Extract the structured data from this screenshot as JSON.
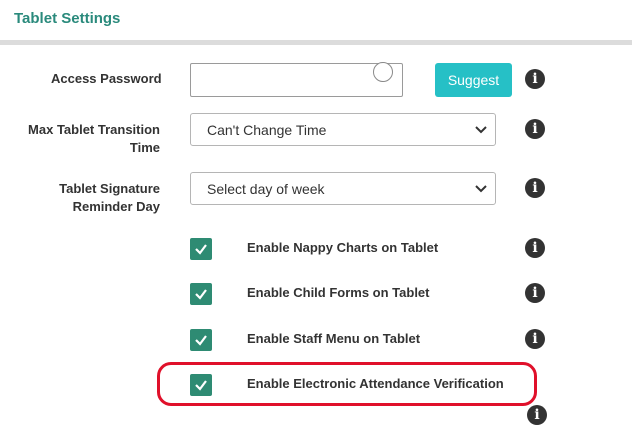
{
  "panel": {
    "title": "Tablet Settings"
  },
  "fields": {
    "access_password": {
      "label": "Access Password",
      "value": "",
      "button": "Suggest"
    },
    "max_transition": {
      "label_line1": "Max Tablet Transition",
      "label_line2": "Time",
      "selected": "Can't Change Time"
    },
    "signature_day": {
      "label_line1": "Tablet Signature",
      "label_line2": "Reminder Day",
      "selected": "Select day of week"
    }
  },
  "checkboxes": [
    {
      "label": "Enable Nappy Charts on Tablet",
      "checked": true
    },
    {
      "label": "Enable Child Forms on Tablet",
      "checked": true
    },
    {
      "label": "Enable Staff Menu on Tablet",
      "checked": true
    },
    {
      "label": "Enable Electronic Attendance Verification",
      "checked": true
    }
  ],
  "icons": {
    "info": "info-icon",
    "check": "check-icon",
    "dropdown": "chevron-down-icon"
  },
  "colors": {
    "accent": "#2a8a7c",
    "button": "#26c0c6",
    "checkbox": "#2e8b73",
    "highlight": "#e0102a"
  }
}
